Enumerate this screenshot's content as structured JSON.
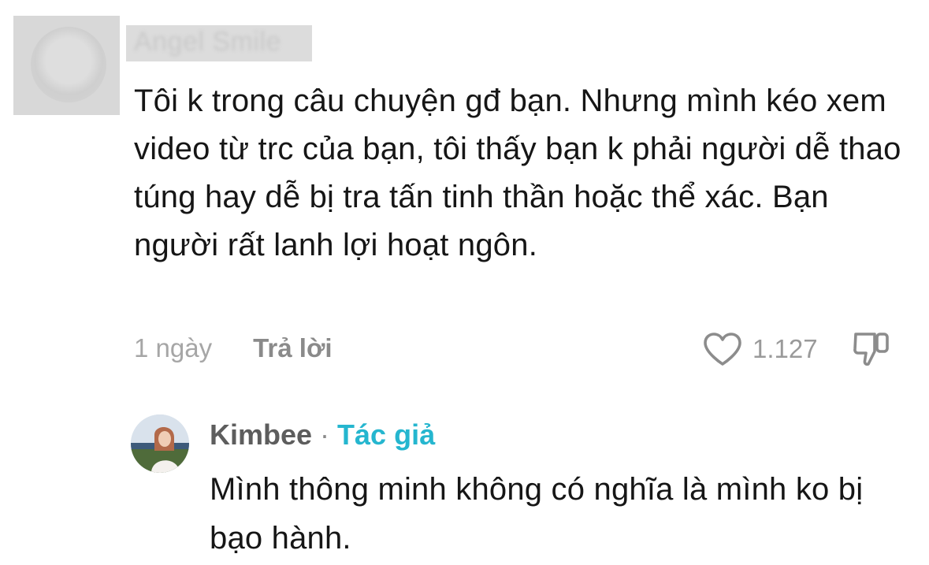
{
  "comment": {
    "username": "Angel Smile",
    "text": "Tôi k trong câu chuyện gđ bạn. Nhưng mình kéo xem video từ trc của bạn, tôi thấy bạn k phải người dễ thao túng hay dễ bị tra tấn tinh thần hoặc thể xác. Bạn người rất lanh lợi hoạt ngôn.",
    "time": "1 ngày",
    "reply_label": "Trả lời",
    "like_count": "1.127",
    "like_icon": "heart-outline-icon",
    "dislike_icon": "thumbs-down-outline-icon"
  },
  "reply": {
    "username": "Kimbee",
    "separator": "·",
    "author_badge": "Tác giả",
    "author_color": "#25b6cf",
    "text": "Mình thông minh không có nghĩa là mình ko bị bạo hành."
  }
}
